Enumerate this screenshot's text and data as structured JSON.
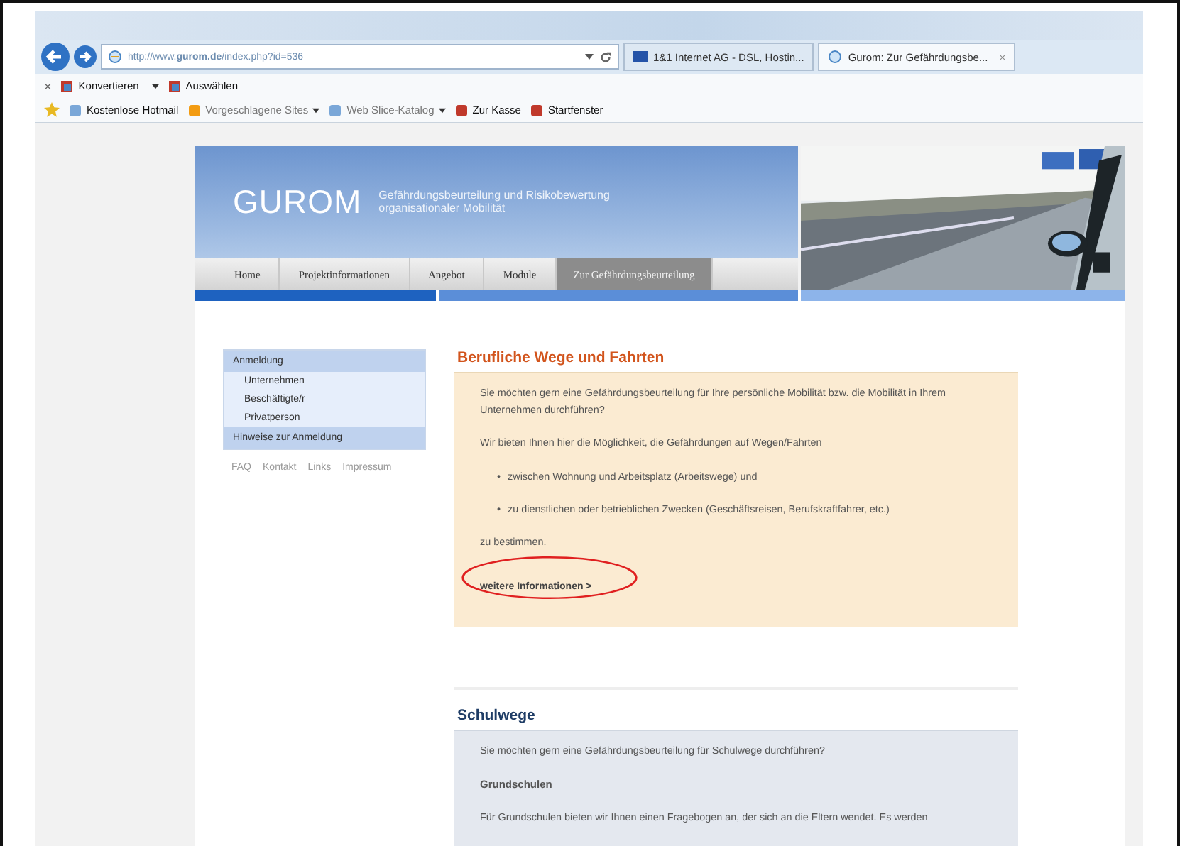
{
  "browser": {
    "address": "http://www.**gurom.de**/index.php?id=536",
    "tabs": [
      {
        "label": "1&1 Internet AG - DSL, Hostin...",
        "selected": false
      },
      {
        "label": "Gurom: Zur Gefährdungsbe...",
        "selected": true,
        "close": "×"
      }
    ],
    "command_bar": [
      {
        "kind": "close",
        "label": "×"
      },
      {
        "kind": "button",
        "label": "Konvertieren",
        "menu": true
      },
      {
        "kind": "button",
        "label": "Auswählen",
        "menu": false
      }
    ],
    "favorites": [
      {
        "label": "Kostenlose Hotmail",
        "menu": false,
        "dimmed": false
      },
      {
        "label": "Vorgeschlagene Sites",
        "menu": true,
        "dimmed": true
      },
      {
        "label": "Web Slice-Katalog",
        "menu": true,
        "dimmed": true
      },
      {
        "label": "Zur Kasse",
        "menu": false,
        "dimmed": false
      },
      {
        "label": "Startfenster",
        "menu": false,
        "dimmed": false
      }
    ]
  },
  "site": {
    "logo": "GUROM",
    "tagline": [
      "Gefährdungsbeurteilung und Risikobewertung",
      "organisationaler Mobilität"
    ],
    "nav": [
      {
        "label": "Home",
        "selected": false
      },
      {
        "label": "Projektinformationen",
        "selected": false
      },
      {
        "label": "Angebot",
        "selected": false
      },
      {
        "label": "Module",
        "selected": false
      },
      {
        "label": "Zur Gefährdungsbeurteilung",
        "selected": true
      }
    ],
    "sidebar": {
      "items": [
        {
          "label": "Anmeldung",
          "kind": "section"
        },
        {
          "label": "Unternehmen",
          "kind": "sub"
        },
        {
          "label": "Beschäftigte/r",
          "kind": "sub"
        },
        {
          "label": "Privatperson",
          "kind": "sub"
        },
        {
          "label": "Hinweise zur Anmeldung",
          "kind": "section"
        }
      ],
      "footer_links": [
        "FAQ",
        "Kontakt",
        "Links",
        "Impressum"
      ]
    },
    "sections": [
      {
        "title": "Berufliche Wege und Fahrten",
        "blocks": [
          {
            "kind": "p",
            "text": "Sie möchten gern eine Gefährdungsbeurteilung für Ihre persönliche Mobilität bzw. die Mobilität in Ihrem Unternehmen durchführen?"
          },
          {
            "kind": "p",
            "text": "Wir bieten Ihnen hier die Möglichkeit, die Gefährdungen auf Wegen/Fahrten"
          },
          {
            "kind": "bullet",
            "marker": "•",
            "text": "zwischen Wohnung und Arbeitsplatz (Arbeitswege) und"
          },
          {
            "kind": "bullet",
            "marker": "•",
            "text": "zu dienstlichen oder betrieblichen Zwecken (Geschäftsreisen, Berufskraftfahrer, etc.)"
          },
          {
            "kind": "p",
            "text": "zu bestimmen."
          },
          {
            "kind": "link",
            "text": "weitere Informationen >",
            "circled": true
          }
        ]
      },
      {
        "title": "Schulwege",
        "blocks": [
          {
            "kind": "p",
            "text": "Sie möchten gern eine Gefährdungsbeurteilung für Schulwege durchführen?"
          },
          {
            "kind": "h",
            "text": "Grundschulen"
          },
          {
            "kind": "p",
            "text": "Für Grundschulen bieten wir Ihnen einen Fragebogen an, der sich an die Eltern wendet. Es werden"
          }
        ]
      }
    ]
  }
}
